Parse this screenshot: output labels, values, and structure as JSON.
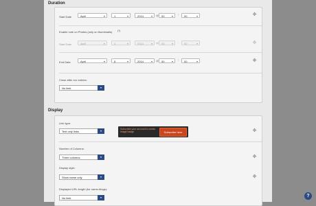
{
  "sections": {
    "duration": "Duration",
    "display": "Display"
  },
  "start_date": {
    "label": "Start Date",
    "month": "April",
    "day": "1",
    "year": "2014",
    "at": "@",
    "hour": "00",
    "minute": "00"
  },
  "photo_voting": {
    "label": "Enable vote on Photos (only on thumbnails)",
    "question": "(?)",
    "start_label": "Start Date",
    "month": "April",
    "day": "4",
    "year": "2014",
    "at": "@",
    "hour": "00",
    "minute": "00"
  },
  "end_date": {
    "label": "End Date",
    "month": "April",
    "day": "8",
    "year": "2014",
    "at": "@",
    "hour": "00",
    "minute": "00"
  },
  "close_after": {
    "label": "Close after xxx entries:",
    "value": "No limit"
  },
  "link_type": {
    "label": "Link type:",
    "value": "Text only links",
    "tooltip_text": "Subscribe your account to create image badge",
    "tooltip_button": "Subscribe here"
  },
  "number_of_columns": {
    "label": "Number of Columns:",
    "value": "Three columns"
  },
  "display_style": {
    "label": "Display style:",
    "value": "Show name only"
  },
  "url_length": {
    "label": "Displayed URL length (for name-blogs):",
    "value": "No limit"
  },
  "help_label": "?",
  "icons": {
    "move": "move-icon",
    "help": "help-icon",
    "dropdown": "chevron-down-icon"
  },
  "colors": {
    "button_blue": "#2c4a86",
    "tooltip_orange": "#c9461f"
  }
}
